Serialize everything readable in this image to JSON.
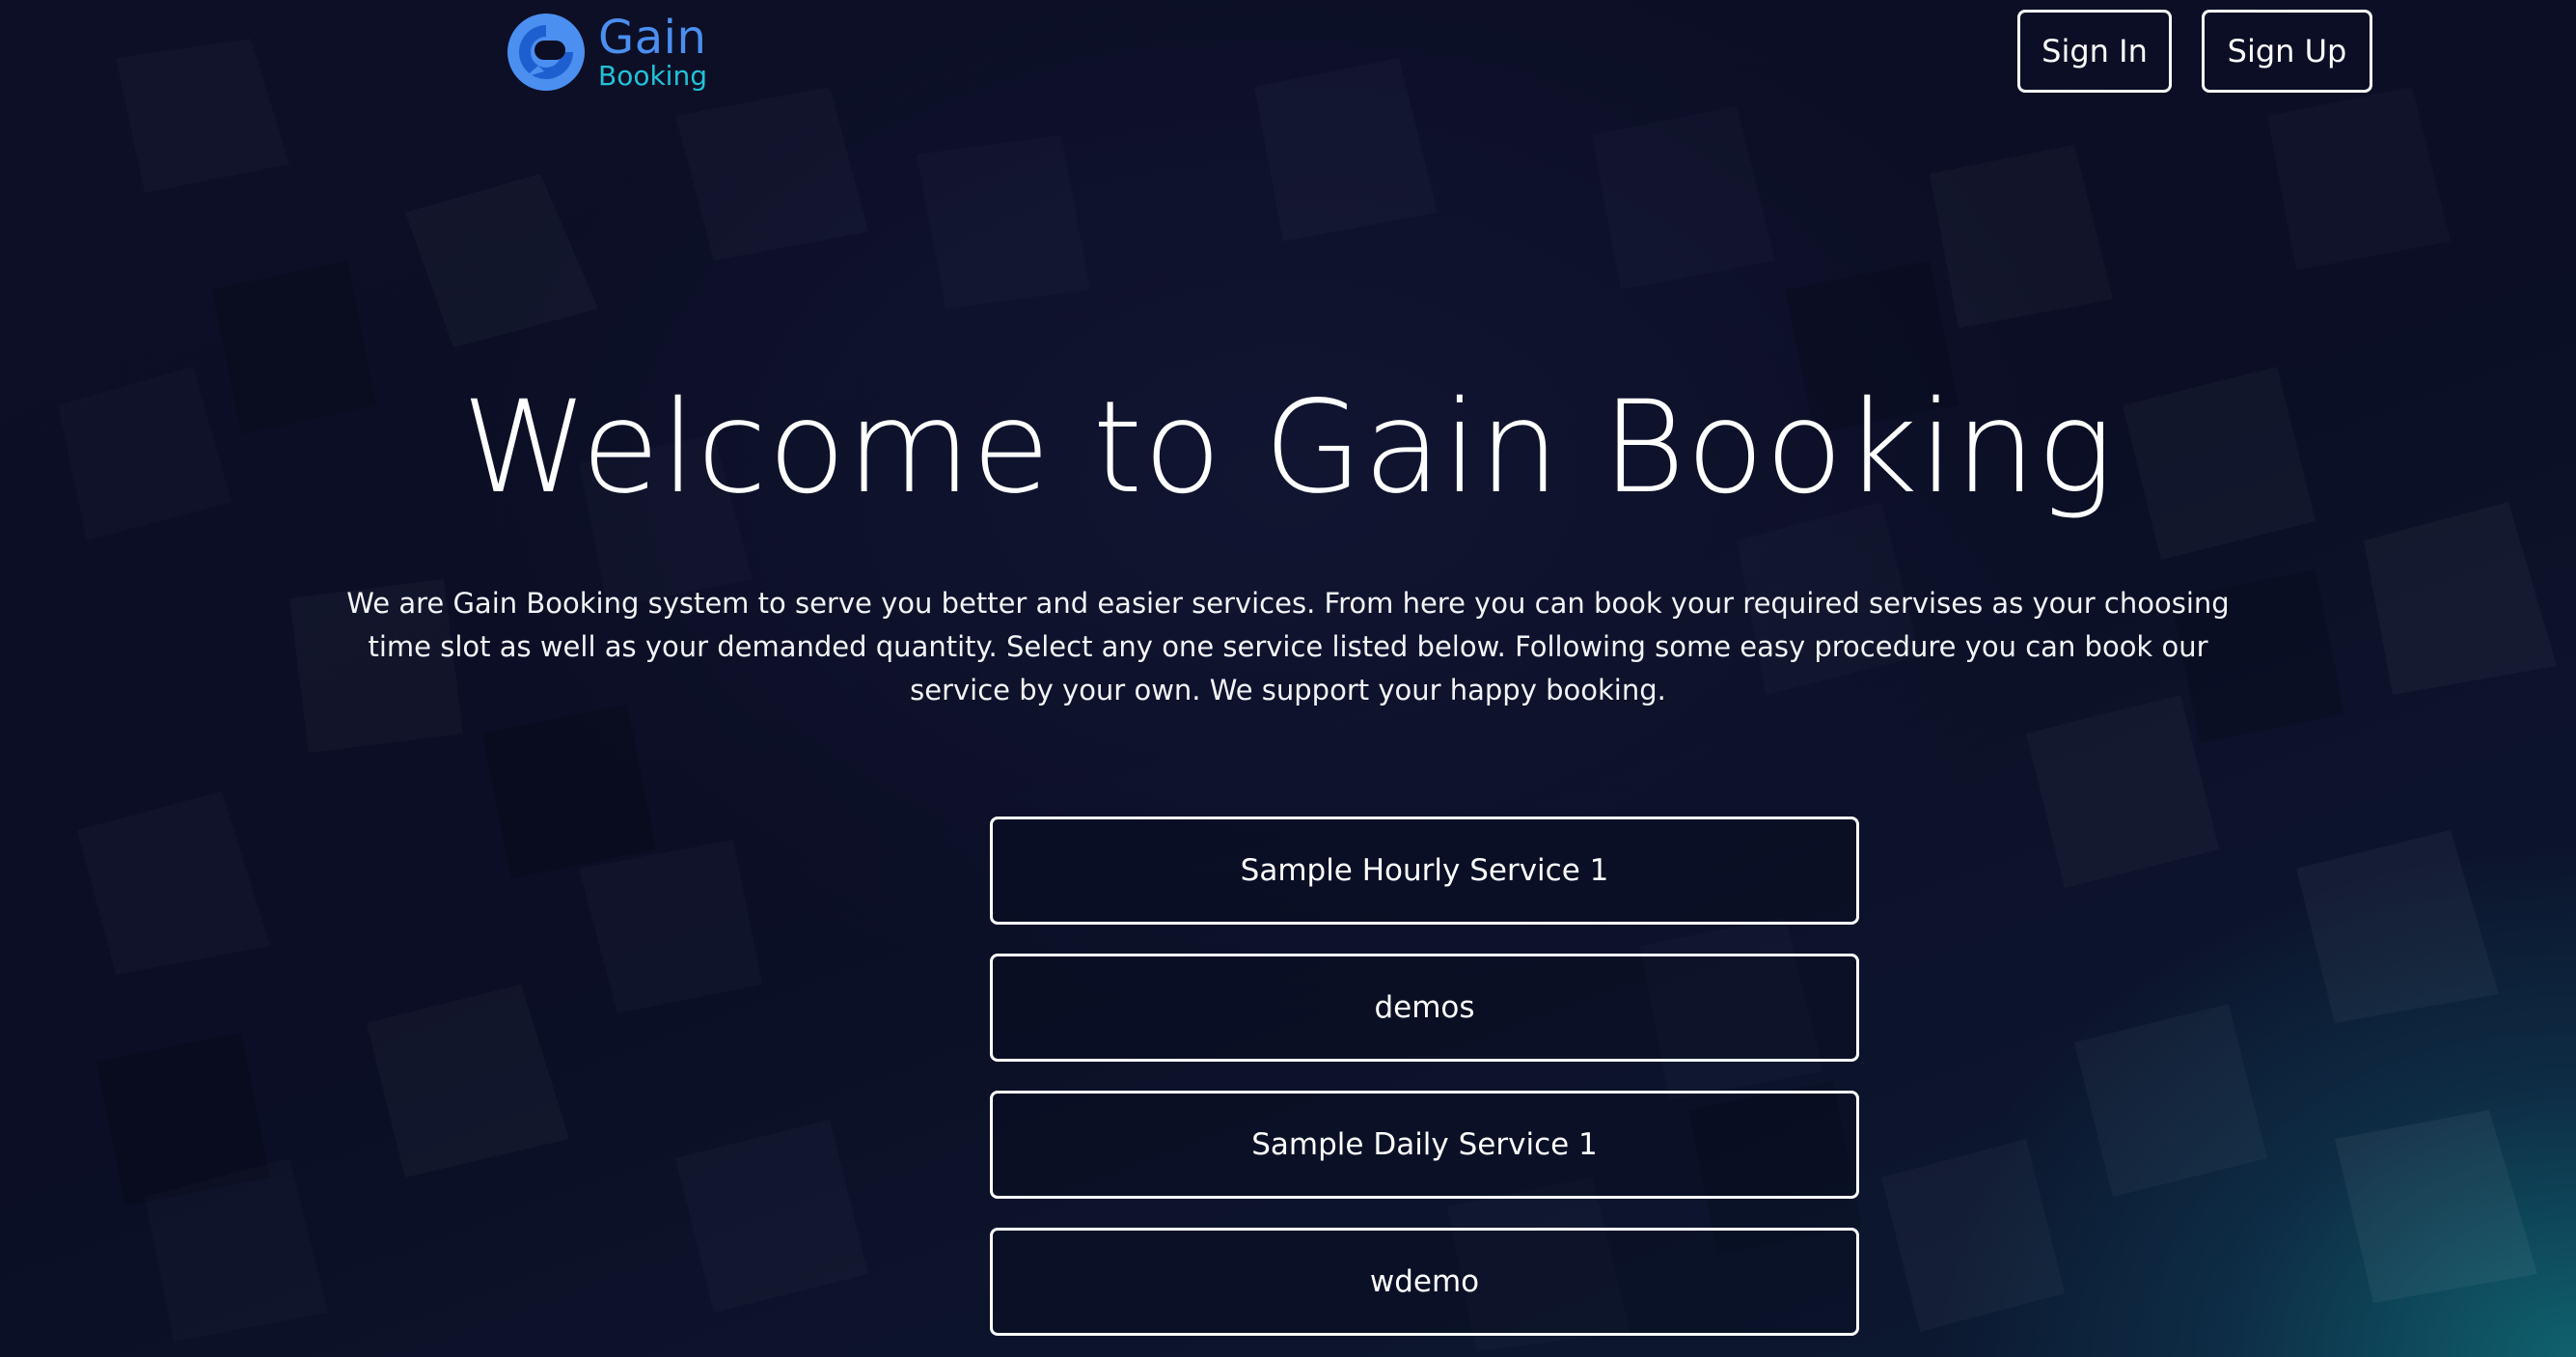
{
  "brand": {
    "name": "Gain",
    "sub": "Booking",
    "icon": "gain-logo-icon",
    "colors": {
      "primary": "#4b8ff0",
      "secondary": "#21c2d8"
    }
  },
  "header": {
    "sign_in_label": "Sign In",
    "sign_up_label": "Sign Up"
  },
  "hero": {
    "title": "Welcome to Gain Booking",
    "description": "We are Gain Booking system to serve you better and easier services. From here you can book your required servises as your choosing time slot as well as your demanded quantity. Select any one service listed below. Following some easy procedure you can book our service by your own. We support your happy booking."
  },
  "services": [
    {
      "label": "Sample Hourly Service 1"
    },
    {
      "label": "demos"
    },
    {
      "label": "Sample Daily Service 1"
    },
    {
      "label": "wdemo"
    }
  ],
  "theme": {
    "background": "#0a0d22",
    "accent_glow": "#106e78",
    "text": "#ffffff"
  }
}
